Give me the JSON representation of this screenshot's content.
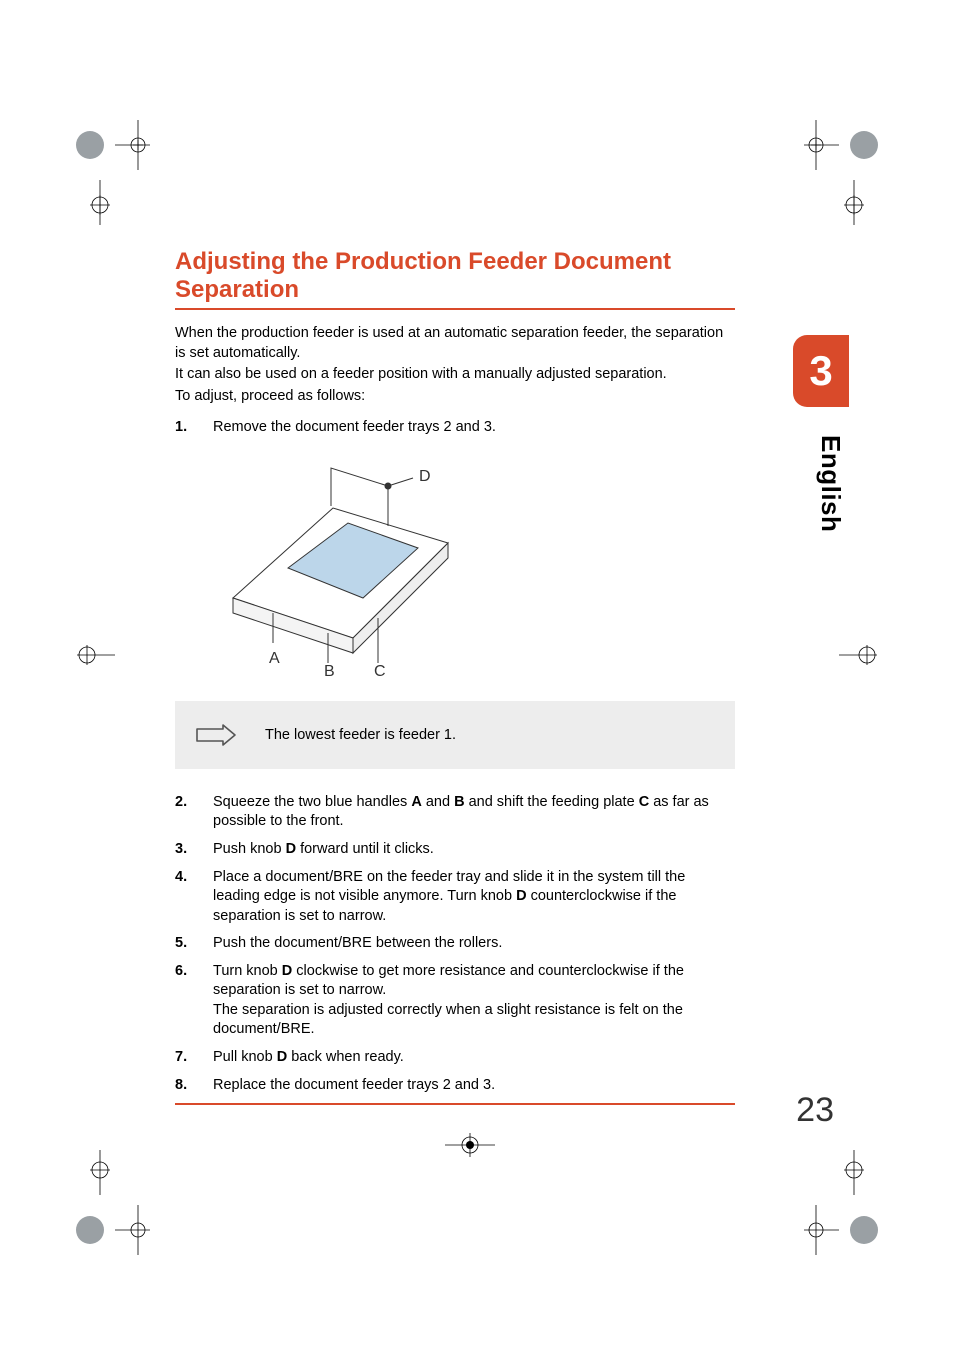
{
  "heading": "Adjusting the Production Feeder Document Separation",
  "intro": {
    "p1": "When the production feeder is used at an automatic separation feeder, the separation is set automatically.",
    "p2": "It can also be used on a feeder position with a manually adjusted separation.",
    "p3": "To adjust, proceed as follows:"
  },
  "steps": [
    {
      "num": "1.",
      "text": "Remove the document feeder trays 2 and 3."
    },
    {
      "num": "2.",
      "html": "Squeeze the two blue handles <b>A</b> and <b>B</b> and shift the feeding plate <b>C</b> as far as possible to the front."
    },
    {
      "num": "3.",
      "html": "Push knob <b>D</b> forward until it clicks."
    },
    {
      "num": "4.",
      "html": "Place a document/BRE on the feeder tray and slide it in the system till the leading edge is not visible anymore. Turn knob <b>D</b> counterclockwise if the separation is set to narrow."
    },
    {
      "num": "5.",
      "text": "Push the document/BRE between the rollers."
    },
    {
      "num": "6.",
      "html": "Turn knob <b>D</b> clockwise to get more resistance and counterclockwise if the separation is set to narrow.",
      "sub": "The separation is adjusted correctly when a slight resistance is felt on the document/BRE."
    },
    {
      "num": "7.",
      "html": "Pull knob <b>D</b> back when ready."
    },
    {
      "num": "8.",
      "text": "Replace the document feeder trays 2 and 3."
    }
  ],
  "note": "The lowest feeder is feeder 1.",
  "chapter_tab": "3",
  "language": "English",
  "page_number": "23",
  "figure_labels": {
    "A": "A",
    "B": "B",
    "C": "C",
    "D": "D"
  }
}
